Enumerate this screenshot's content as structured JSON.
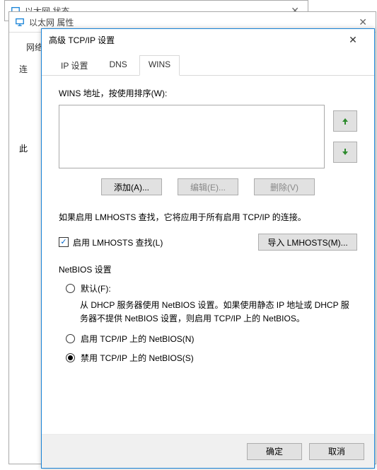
{
  "bg1": {
    "title": "以太网 状态"
  },
  "bg2": {
    "title": "以太网 属性",
    "tab_network": "网络",
    "label_connect": "连"
  },
  "bg3": {
    "label_this": "此"
  },
  "dialog": {
    "title": "高级 TCP/IP 设置",
    "tabs": {
      "ip": "IP 设置",
      "dns": "DNS",
      "wins": "WINS"
    },
    "wins_label": "WINS 地址，按使用排序(W):",
    "buttons": {
      "add": "添加(A)...",
      "edit": "编辑(E)...",
      "remove": "删除(V)"
    },
    "lmhosts_text": "如果启用 LMHOSTS 查找，它将应用于所有启用 TCP/IP 的连接。",
    "enable_lmhosts": "启用 LMHOSTS 查找(L)",
    "import_lmhosts": "导入 LMHOSTS(M)...",
    "netbios_group": "NetBIOS 设置",
    "radios": {
      "default": "默认(F):",
      "default_desc": "从 DHCP 服务器使用 NetBIOS 设置。如果使用静态 IP 地址或 DHCP 服务器不提供 NetBIOS 设置，则启用 TCP/IP 上的 NetBIOS。",
      "enable": "启用 TCP/IP 上的 NetBIOS(N)",
      "disable": "禁用 TCP/IP 上的 NetBIOS(S)"
    },
    "footer": {
      "ok": "确定",
      "cancel": "取消"
    }
  },
  "state": {
    "lmhosts_checked": true,
    "netbios_selected": "disable"
  }
}
